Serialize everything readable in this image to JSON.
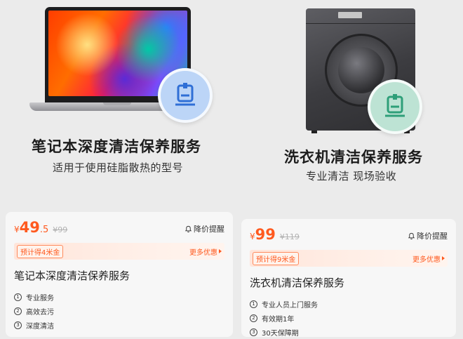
{
  "left": {
    "title": "笔记本深度清洁保养服务",
    "subtitle": "适用于使用硅脂散热的型号",
    "card": {
      "currency": "¥",
      "price_int": "49",
      "price_dec": ".5",
      "orig_price": "¥99",
      "remind": "降价提醒",
      "promo": "预计得4米金",
      "more": "更多优惠",
      "name": "笔记本深度清洁保养服务",
      "features": [
        {
          "num": "1",
          "text": "专业服务"
        },
        {
          "num": "2",
          "text": "高效去污"
        },
        {
          "num": "3",
          "text": "深度清洁"
        }
      ]
    },
    "badge_color": "#bcd5f7"
  },
  "right": {
    "title": "洗衣机清洁保养服务",
    "subtitle": "专业清洁 现场验收",
    "card": {
      "currency": "¥",
      "price_int": "99",
      "price_dec": "",
      "orig_price": "¥119",
      "remind": "降价提醒",
      "promo": "预计得9米金",
      "more": "更多优惠",
      "name": "洗衣机清洁保养服务",
      "features": [
        {
          "num": "1",
          "text": "专业人员上门服务"
        },
        {
          "num": "2",
          "text": "有效期1年"
        },
        {
          "num": "3",
          "text": "30天保障期"
        }
      ]
    },
    "badge_color": "#bde3d4"
  },
  "colors": {
    "accent": "#ff5a1f",
    "background": "#ebebeb",
    "card": "#f7f7f7"
  },
  "icons": [
    "laptop-image",
    "washer-image",
    "cleaning-service-icon",
    "bell-icon",
    "chevron-right-icon"
  ]
}
